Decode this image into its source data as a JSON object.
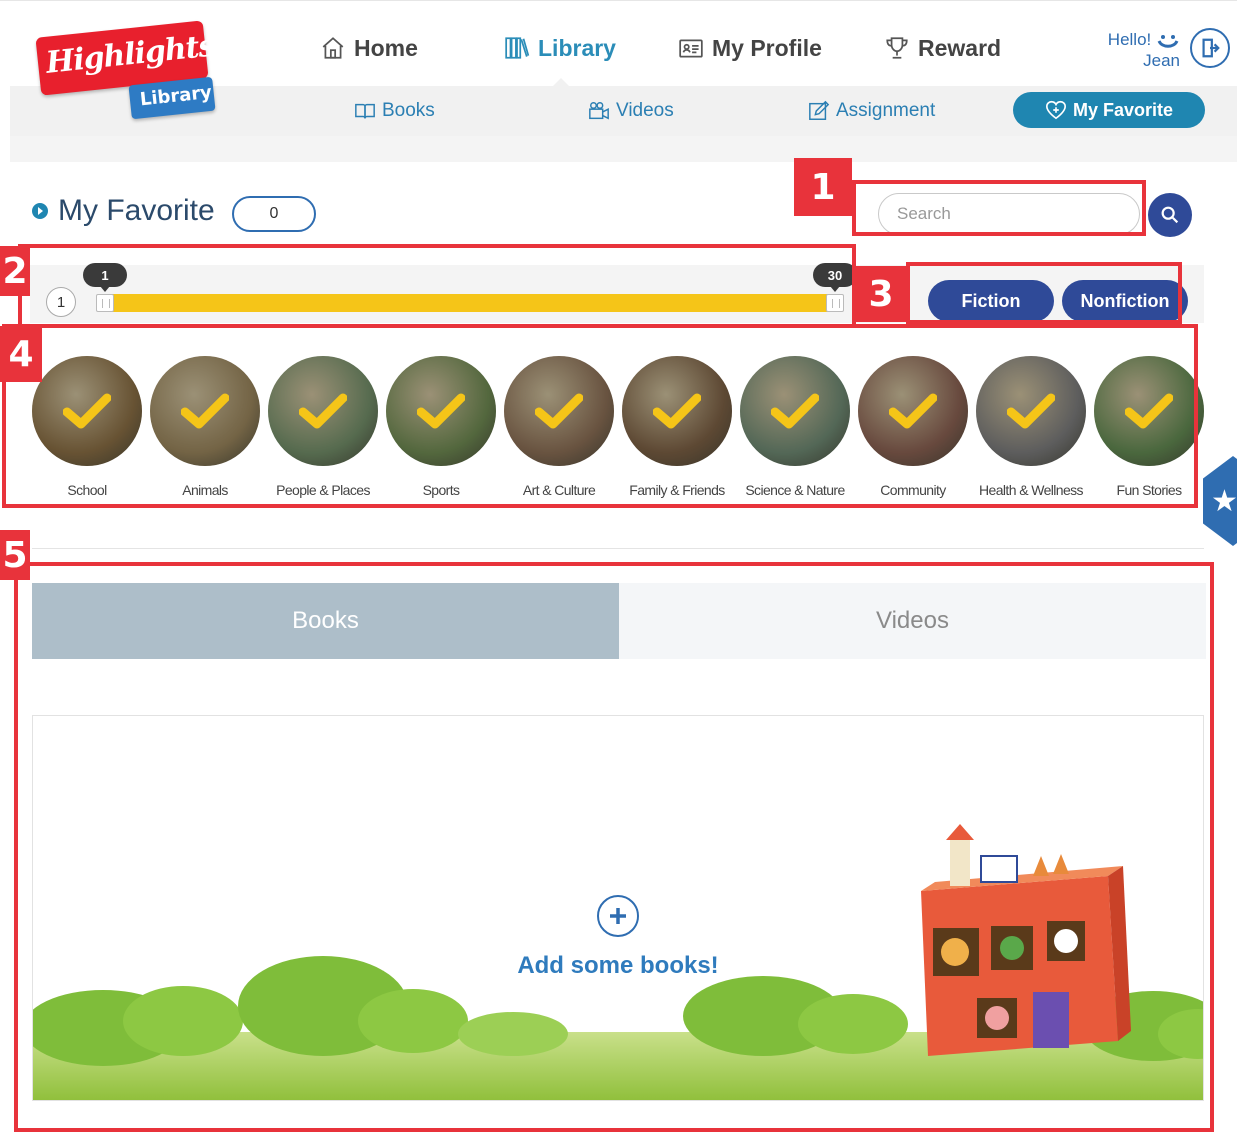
{
  "nav": {
    "logo_main": "Highlights",
    "logo_sub": "Library",
    "items": [
      {
        "label": "Home",
        "icon": "house-icon",
        "active": false
      },
      {
        "label": "Library",
        "icon": "books-icon",
        "active": true
      },
      {
        "label": "My Profile",
        "icon": "id-card-icon",
        "active": false
      },
      {
        "label": "Reward",
        "icon": "trophy-icon",
        "active": false
      }
    ],
    "greeting": "Hello!",
    "user_name": "Jean"
  },
  "subnav": {
    "items": [
      {
        "label": "Books",
        "icon": "book-icon"
      },
      {
        "label": "Videos",
        "icon": "video-icon"
      },
      {
        "label": "Assignment",
        "icon": "edit-icon"
      }
    ],
    "active_label": "My Favorite"
  },
  "favorite": {
    "title": "My Favorite",
    "count": "0"
  },
  "search": {
    "placeholder": "Search"
  },
  "level_slider": {
    "min_label": "1",
    "low_value": "1",
    "high_value": "30"
  },
  "genre_buttons": [
    "Fiction",
    "Nonfiction"
  ],
  "categories": [
    {
      "label": "School",
      "color": "#8a6a3a",
      "selected": true
    },
    {
      "label": "Animals",
      "color": "#9c8455",
      "selected": true
    },
    {
      "label": "People & Places",
      "color": "#6f8f64",
      "selected": true
    },
    {
      "label": "Sports",
      "color": "#6b8a4a",
      "selected": true
    },
    {
      "label": "Art & Culture",
      "color": "#8c6b4e",
      "selected": true
    },
    {
      "label": "Family & Friends",
      "color": "#7a5a3a",
      "selected": true
    },
    {
      "label": "Science & Nature",
      "color": "#6b8a70",
      "selected": true
    },
    {
      "label": "Community",
      "color": "#8a5b4a",
      "selected": true
    },
    {
      "label": "Health & Wellness",
      "color": "#7a7a7a",
      "selected": true
    },
    {
      "label": "Fun Stories",
      "color": "#5d8a4a",
      "selected": true
    }
  ],
  "tabs": [
    {
      "label": "Books",
      "active": true
    },
    {
      "label": "Videos",
      "active": false
    }
  ],
  "empty_state": {
    "message": "Add some books!"
  },
  "annotations": [
    "1",
    "2",
    "3",
    "4",
    "5"
  ],
  "colors": {
    "brand_red": "#e8202d",
    "brand_blue": "#2f4a98",
    "accent_teal": "#1f86b1",
    "slider_fill": "#f5c518",
    "annotation_red": "#e8333b"
  }
}
